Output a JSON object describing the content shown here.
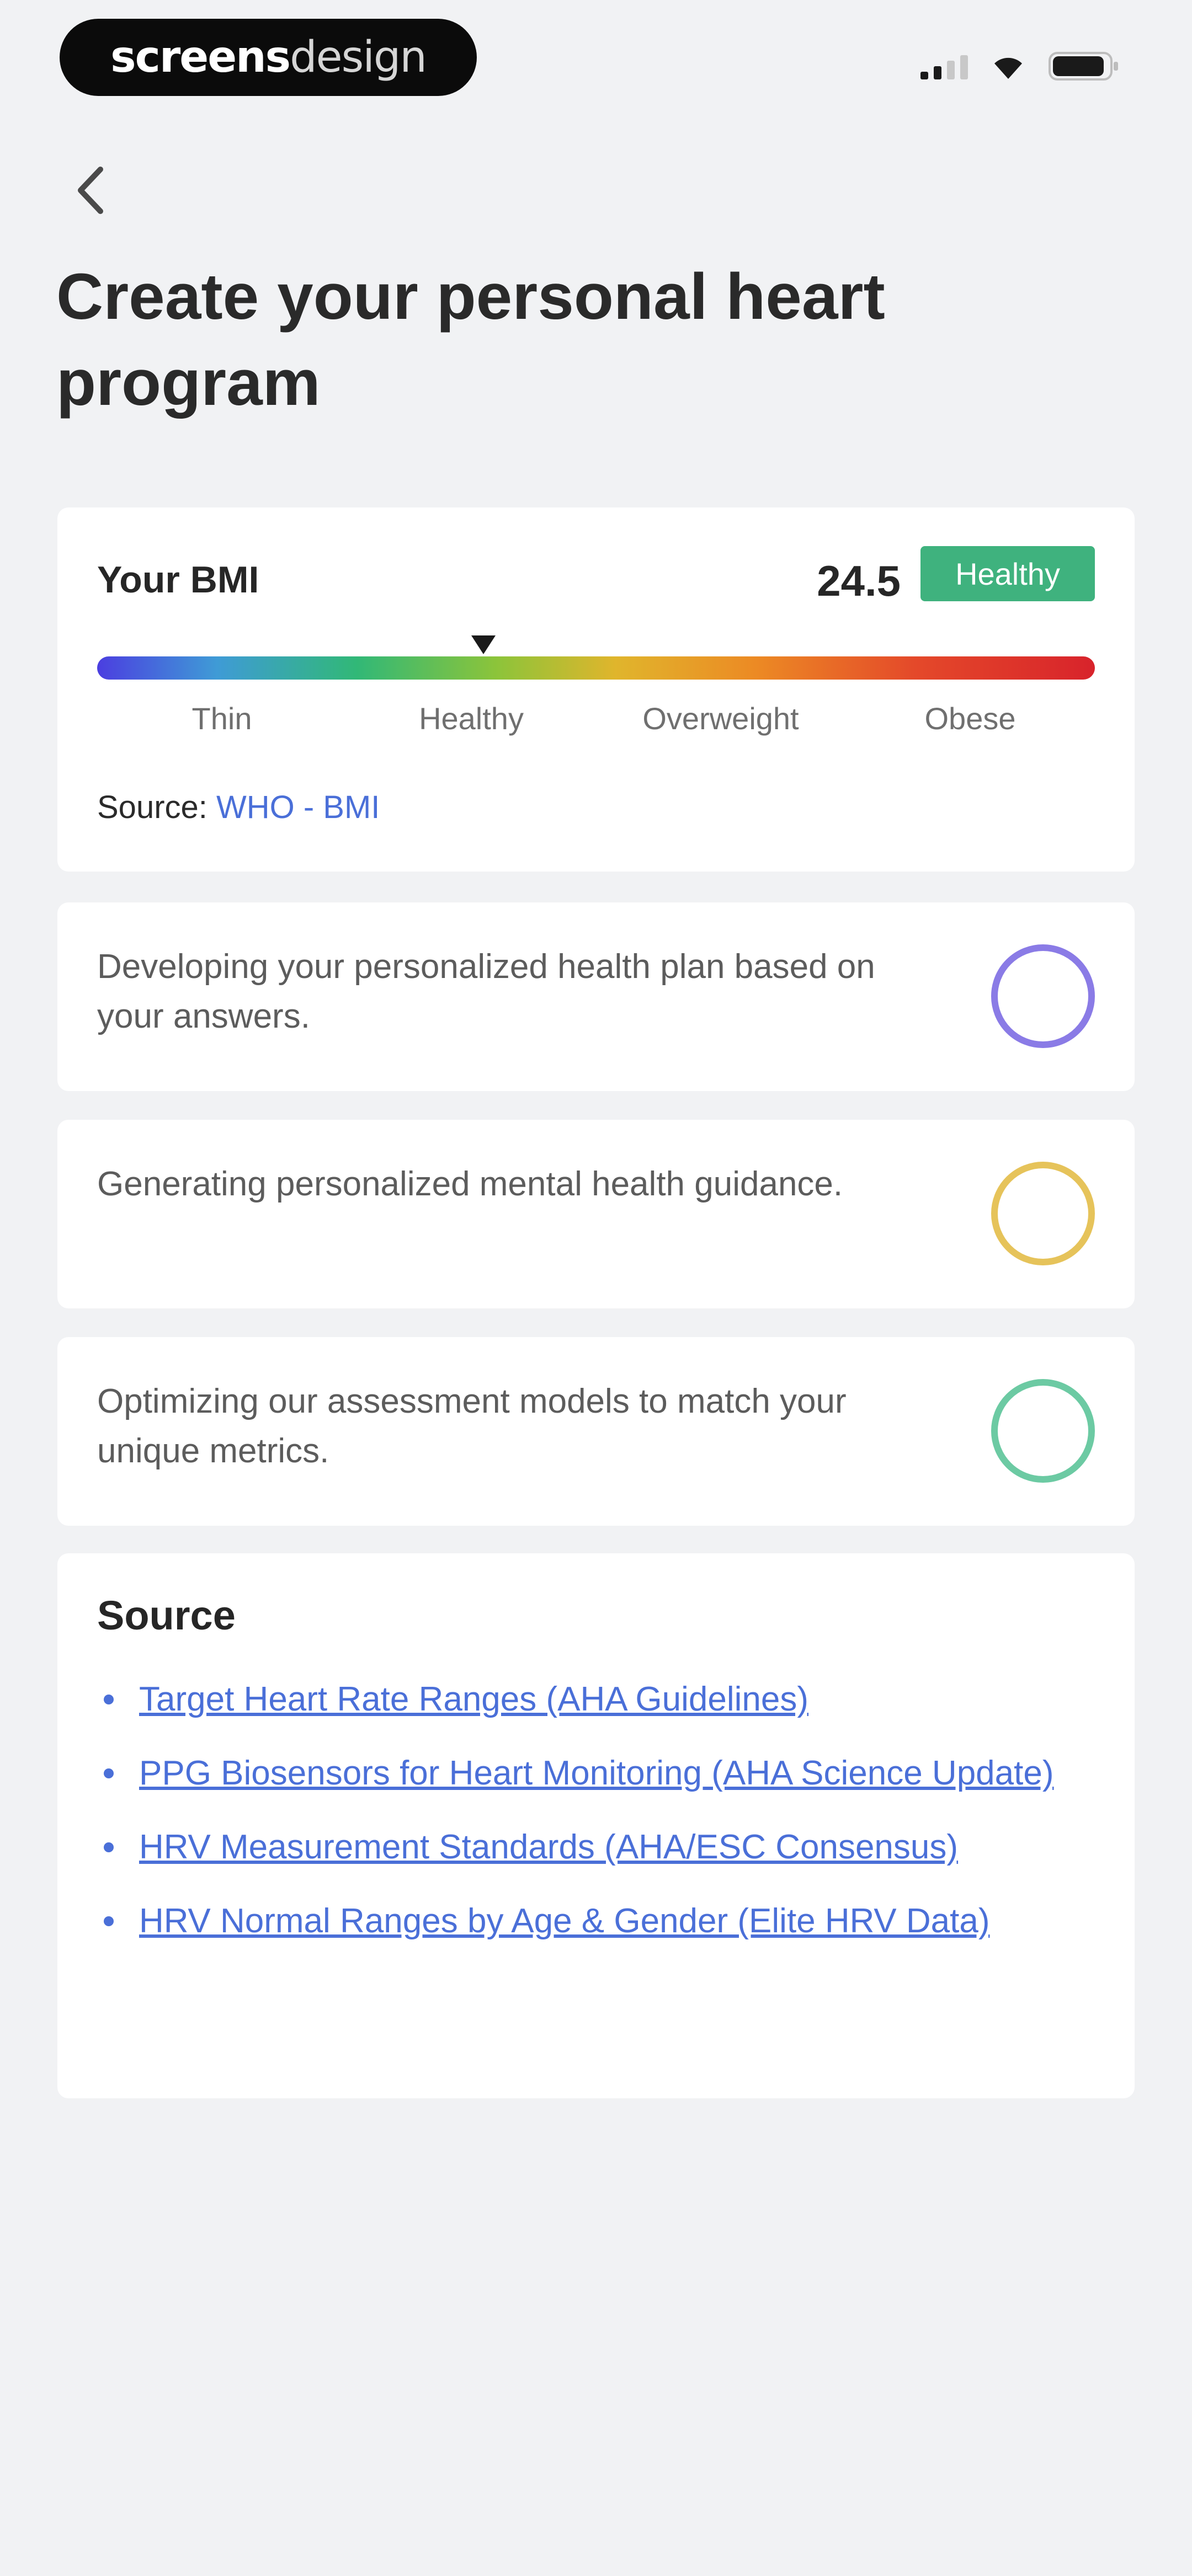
{
  "status_bar": {
    "brand_bold": "screens",
    "brand_light": "design",
    "signal_bars_active": 2,
    "signal_bars_total": 4
  },
  "header": {
    "back_icon": "chevron-left-icon",
    "title": "Create your personal heart program"
  },
  "bmi": {
    "label": "Your BMI",
    "value": "24.5",
    "status": "Healthy",
    "status_color": "#3fb27e",
    "scale_labels": [
      "Thin",
      "Healthy",
      "Overweight",
      "Obese"
    ],
    "source_prefix": "Source:",
    "source_link": "WHO - BMI"
  },
  "progress": [
    {
      "text": "Developing your personalized health plan based on your answers.",
      "ring_color": "#8a7be6"
    },
    {
      "text": "Generating personalized mental health guidance.",
      "ring_color": "#e6c35a"
    },
    {
      "text": "Optimizing our assessment models to match your unique metrics.",
      "ring_color": "#6ccaa3"
    }
  ],
  "sources": {
    "heading": "Source",
    "items": [
      "Target Heart Rate Ranges (AHA Guidelines)",
      "PPG Biosensors for Heart Monitoring (AHA Science Update)",
      "HRV Measurement Standards (AHA/ESC Consensus)",
      "HRV Normal Ranges by Age & Gender (Elite HRV Data)"
    ]
  },
  "colors": {
    "background": "#f1f2f4",
    "link": "#4a6fd8",
    "card": "#ffffff"
  }
}
